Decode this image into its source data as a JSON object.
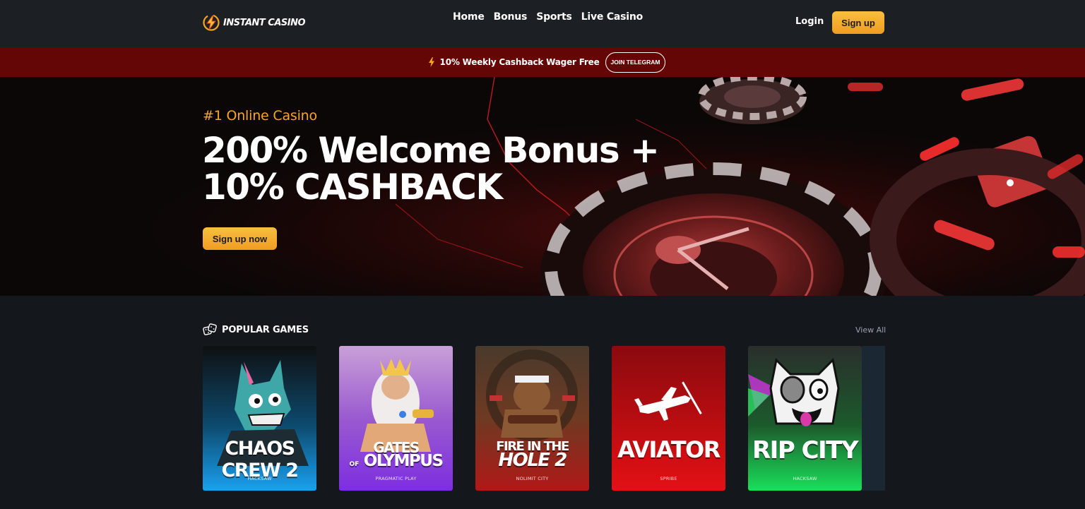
{
  "header": {
    "logo_text": "INSTANT CASINO",
    "nav": [
      "Home",
      "Bonus",
      "Sports",
      "Live Casino"
    ],
    "login_label": "Login",
    "signup_label": "Sign up"
  },
  "promo": {
    "text": "10% Weekly Cashback Wager Free",
    "button_label": "JOIN TELEGRAM"
  },
  "hero": {
    "tagline": "#1 Online Casino",
    "title_line1": "200% Welcome Bonus +",
    "title_line2": "10% CASHBACK",
    "cta_label": "Sign up now"
  },
  "popular": {
    "title": "POPULAR GAMES",
    "view_all": "View All",
    "games": [
      {
        "title_line1": "CHAOS CREW 2",
        "title_line2": "",
        "provider": "HACKSAW"
      },
      {
        "title_line1": "GATES",
        "title_line2": "OLYMPUS",
        "title_of": "OF",
        "provider": "PRAGMATIC PLAY"
      },
      {
        "title_line1": "FIRE IN THE",
        "title_line2": "HOLE 2",
        "provider": "NOLIMIT CITY"
      },
      {
        "title_line1": "AVIATOR",
        "title_line2": "",
        "provider": "SPRIBE"
      },
      {
        "title_line1": "RIP CITY",
        "title_line2": "",
        "provider": "HACKSAW"
      }
    ]
  },
  "colors": {
    "accent": "#f5a623",
    "button_gradient_top": "#f9bf3f",
    "button_gradient_bottom": "#f09c22",
    "header_bg": "#1c1f24",
    "promo_bg": "#650606",
    "page_bg": "#14181d"
  },
  "icons": {
    "logo": "lightning-bolt-logo-icon",
    "promo": "lightning-bolt-icon",
    "section": "dice-icon"
  }
}
